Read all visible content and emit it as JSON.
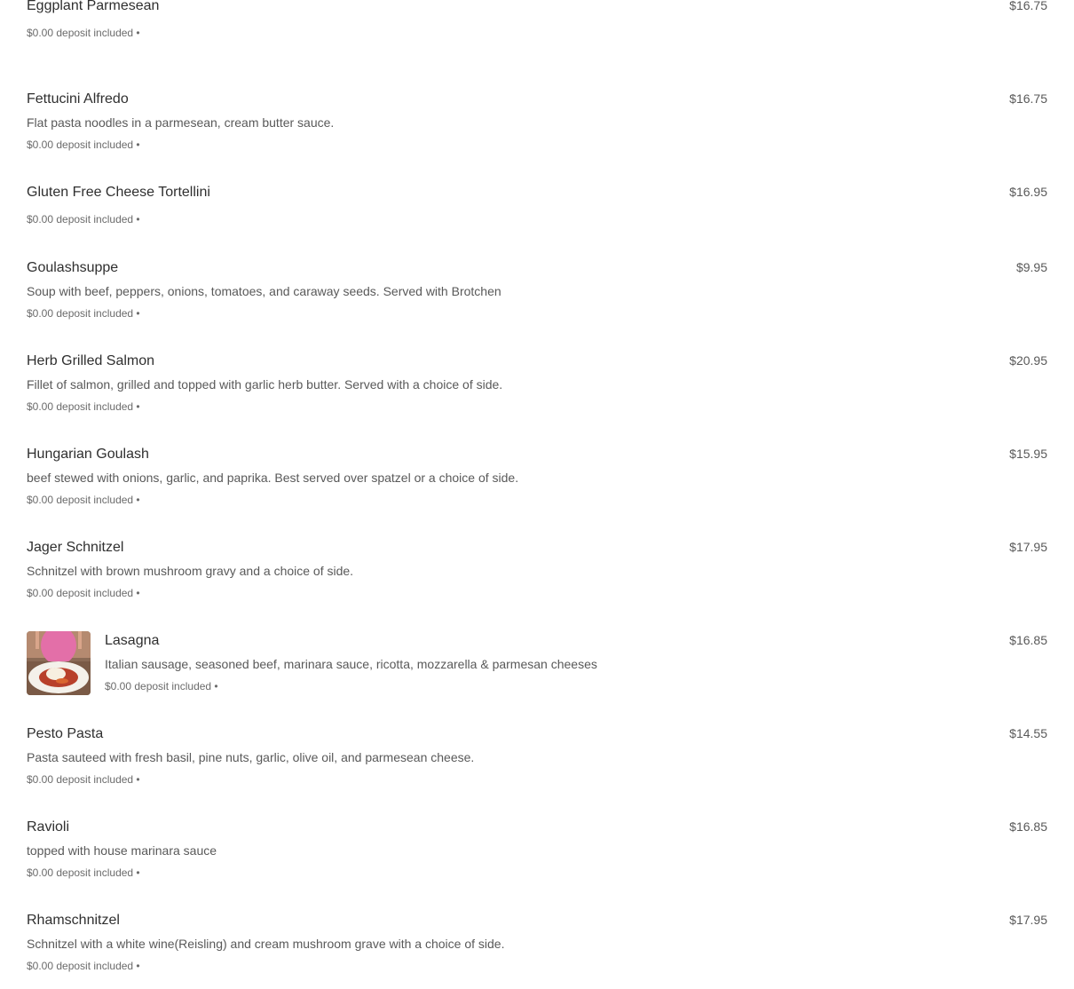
{
  "menu": {
    "items": [
      {
        "name": "Eggplant Parmesean",
        "description": "",
        "deposit": "$0.00 deposit included •",
        "price": "$16.75"
      },
      {
        "name": "Fettucini Alfredo",
        "description": "Flat pasta noodles in a parmesean, cream butter sauce.",
        "deposit": "$0.00 deposit included •",
        "price": "$16.75"
      },
      {
        "name": "Gluten Free Cheese Tortellini",
        "description": "",
        "deposit": "$0.00 deposit included •",
        "price": "$16.95"
      },
      {
        "name": "Goulashsuppe",
        "description": "Soup with beef, peppers, onions, tomatoes, and caraway seeds. Served with Brotchen",
        "deposit": "$0.00 deposit included •",
        "price": "$9.95"
      },
      {
        "name": "Herb Grilled Salmon",
        "description": "Fillet of salmon, grilled and topped with garlic herb butter. Served with a choice of side.",
        "deposit": "$0.00 deposit included •",
        "price": "$20.95"
      },
      {
        "name": "Hungarian Goulash",
        "description": "beef stewed with onions, garlic, and paprika. Best served over spatzel or a choice of side.",
        "deposit": "$0.00 deposit included •",
        "price": "$15.95"
      },
      {
        "name": "Jager Schnitzel",
        "description": "Schnitzel with brown mushroom gravy and a choice of side.",
        "deposit": "$0.00 deposit included •",
        "price": "$17.95"
      },
      {
        "name": "Lasagna",
        "description": "Italian sausage, seasoned beef, marinara sauce, ricotta, mozzarella & parmesan cheeses",
        "deposit": "$0.00 deposit included •",
        "price": "$16.85"
      },
      {
        "name": "Pesto Pasta",
        "description": "Pasta sauteed with fresh basil, pine nuts, garlic, olive oil, and parmesean cheese.",
        "deposit": "$0.00 deposit included •",
        "price": "$14.55"
      },
      {
        "name": "Ravioli",
        "description": "topped with house marinara sauce",
        "deposit": "$0.00 deposit included •",
        "price": "$16.85"
      },
      {
        "name": "Rhamschnitzel",
        "description": "Schnitzel with a white wine(Reisling) and cream mushroom grave with a choice of side.",
        "deposit": "$0.00 deposit included •",
        "price": "$17.95"
      }
    ]
  },
  "colors": {
    "text_primary": "#2f2f2f",
    "text_secondary": "#595959",
    "background": "#ffffff"
  }
}
